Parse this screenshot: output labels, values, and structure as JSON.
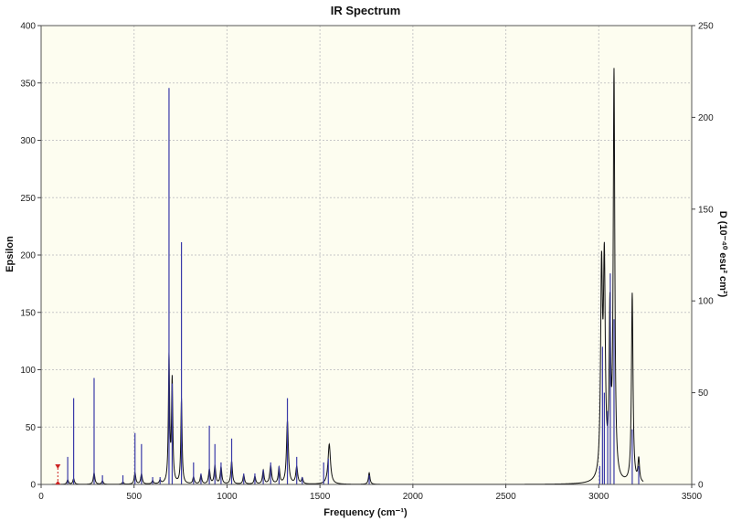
{
  "chart_data": {
    "type": "line",
    "title": "IR Spectrum",
    "xlabel": "Frequency (cm⁻¹)",
    "ylabel": "Epsilon",
    "y2label": "D (10⁻⁴⁰ esu² cm²)",
    "xlim": [
      0,
      3500
    ],
    "ylim": [
      0,
      400
    ],
    "y2lim": [
      0,
      250
    ],
    "xticks": [
      0,
      500,
      1000,
      1500,
      2000,
      2500,
      3000,
      3500
    ],
    "yticks": [
      0,
      50,
      100,
      150,
      200,
      250,
      300,
      350,
      400
    ],
    "y2ticks": [
      0,
      50,
      100,
      150,
      200,
      250
    ],
    "grid": true,
    "colors": {
      "background": "#fdfdf0",
      "grid": "#c8c8c8",
      "spectrum": "#111111",
      "sticks": "#3a3aa8",
      "marker": "#cc2222"
    },
    "series": [
      {
        "kind": "spectrum",
        "axis": "left",
        "x": [
          143,
          175,
          285,
          330,
          440,
          505,
          540,
          600,
          640,
          688,
          705,
          755,
          820,
          860,
          905,
          935,
          968,
          1025,
          1090,
          1150,
          1195,
          1235,
          1280,
          1325,
          1375,
          1405,
          1550,
          1765,
          3015,
          3030,
          3060,
          3082,
          3180,
          3215
        ],
        "y": [
          4,
          5,
          10,
          3,
          2,
          10,
          9,
          3,
          3,
          110,
          89,
          74,
          6,
          8,
          13,
          16,
          15,
          20,
          8,
          7,
          12,
          16,
          14,
          55,
          15,
          5,
          35,
          10,
          175,
          180,
          140,
          352,
          165,
          20
        ],
        "w": [
          5,
          5,
          5,
          5,
          5,
          5,
          5,
          5,
          5,
          4,
          4,
          4,
          5,
          5,
          5,
          5,
          5,
          5,
          5,
          5,
          5,
          6,
          5,
          6,
          6,
          5,
          8,
          5,
          6,
          6,
          5,
          5,
          5,
          5
        ]
      },
      {
        "kind": "sticks",
        "axis": "right",
        "x": [
          143,
          175,
          285,
          330,
          440,
          505,
          540,
          600,
          640,
          688,
          705,
          755,
          820,
          860,
          905,
          935,
          968,
          1025,
          1090,
          1150,
          1195,
          1235,
          1280,
          1325,
          1375,
          1405,
          1520,
          1545,
          1765,
          3005,
          3020,
          3030,
          3048,
          3062,
          3082,
          3180,
          3215
        ],
        "y": [
          15,
          47,
          58,
          5,
          5,
          28,
          22,
          4,
          4,
          216,
          55,
          132,
          12,
          6,
          32,
          22,
          12,
          25,
          6,
          6,
          8,
          12,
          10,
          47,
          15,
          4,
          12,
          14,
          5,
          10,
          75,
          50,
          40,
          115,
          90,
          30,
          10
        ]
      }
    ],
    "annotations": [
      {
        "kind": "marker",
        "x": 90,
        "y": 0
      }
    ]
  }
}
